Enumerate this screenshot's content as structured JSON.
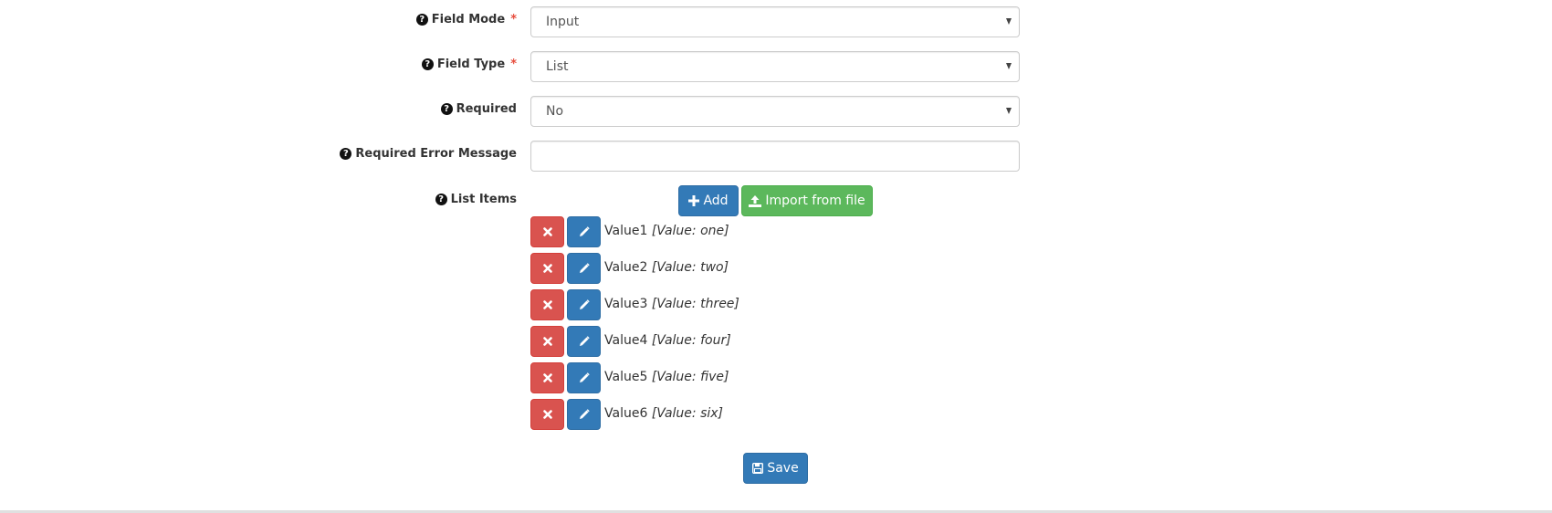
{
  "form": {
    "fields": [
      {
        "label": "Field Mode",
        "required_mark": "*",
        "type": "select",
        "value": "Input"
      },
      {
        "label": "Field Type",
        "required_mark": "*",
        "type": "select",
        "value": "List"
      },
      {
        "label": "Required",
        "required_mark": "",
        "type": "select",
        "value": "No"
      },
      {
        "label": "Required Error Message",
        "required_mark": "",
        "type": "text",
        "value": ""
      }
    ],
    "help_icon": "?",
    "list_items": {
      "label": "List Items",
      "add_label": "Add",
      "import_label": "Import from file",
      "items": [
        {
          "name": "Value1",
          "value_text": "[Value: one]"
        },
        {
          "name": "Value2",
          "value_text": "[Value: two]"
        },
        {
          "name": "Value3",
          "value_text": "[Value: three]"
        },
        {
          "name": "Value4",
          "value_text": "[Value: four]"
        },
        {
          "name": "Value5",
          "value_text": "[Value: five]"
        },
        {
          "name": "Value6",
          "value_text": "[Value: six]"
        }
      ]
    },
    "save_label": "Save"
  },
  "colors": {
    "primary": "#337ab7",
    "success": "#5cb85c",
    "danger": "#d9534f",
    "required_mark": "#e74c3c"
  }
}
